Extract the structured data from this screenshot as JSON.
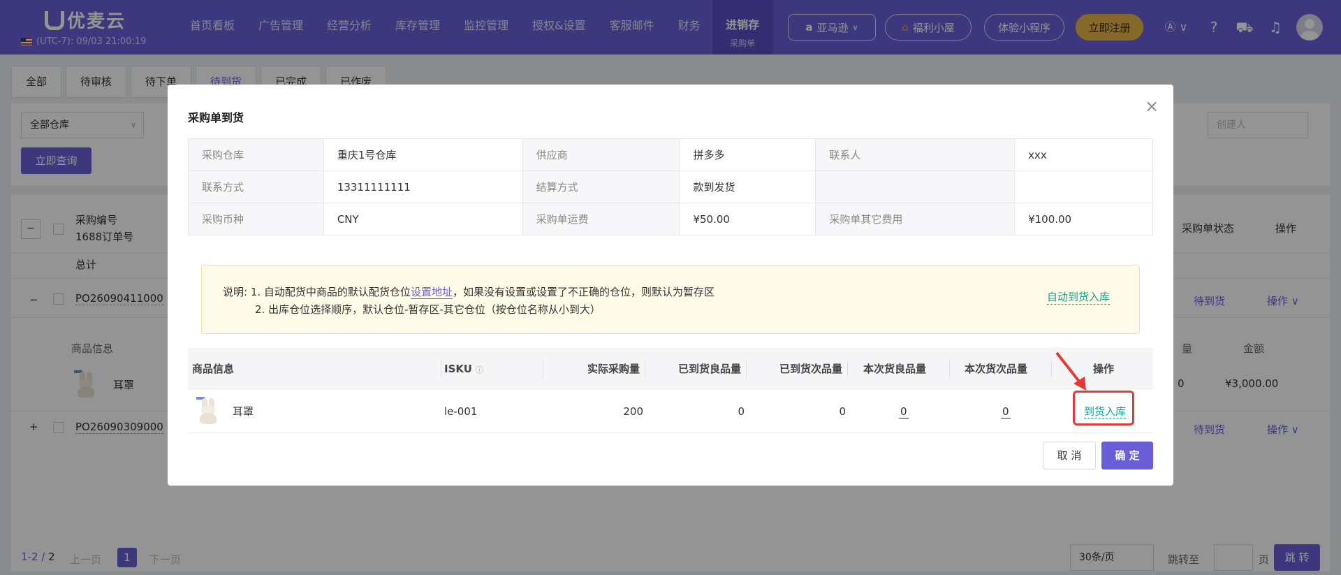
{
  "header": {
    "brand": "优麦云",
    "timezone": "(UTC-7): 09/03 21:00:19",
    "nav": [
      "首页看板",
      "广告管理",
      "经营分析",
      "库存管理",
      "监控管理",
      "授权&设置",
      "客服邮件",
      "财务"
    ],
    "active_nav": "进销存",
    "active_nav_sub": "采购单",
    "platform": "亚马逊",
    "welfare": "福利小屋",
    "mini_program": "体验小程序",
    "register": "立即注册"
  },
  "page": {
    "tabs": [
      "全部",
      "待审核",
      "待下单",
      "待到货",
      "已完成",
      "已作废"
    ],
    "active_tab": "待到货",
    "warehouse_select": "全部仓库",
    "creator_placeholder": "创建人",
    "query_button": "立即查询",
    "list_headers": {
      "po_no": "采购编号",
      "order_1688": "1688订单号",
      "total": "总计",
      "po_status": "采购单状态",
      "ops": "操作",
      "product_info": "商品信息",
      "qty": "量",
      "amount": "金额"
    },
    "rows": [
      {
        "po": "PO26090411000",
        "status": "待到货",
        "ops": "操作"
      },
      {
        "po": "PO26090309000",
        "status": "待到货",
        "ops": "操作"
      }
    ],
    "sub_item": {
      "name": "耳罩",
      "qty": "0",
      "amount": "¥3,000.00"
    },
    "pagination": {
      "range": "1-2",
      "total": "2",
      "prev": "上一页",
      "current": "1",
      "next": "下一页",
      "page_size": "30条/页",
      "jump_label": "跳转至",
      "page_unit": "页",
      "jump_button": "跳 转"
    }
  },
  "modal": {
    "title": "采购单到货",
    "info": {
      "warehouse_label": "采购仓库",
      "warehouse": "重庆1号仓库",
      "supplier_label": "供应商",
      "supplier": "拼多多",
      "contact_label": "联系人",
      "contact": "xxx",
      "phone_label": "联系方式",
      "phone": "13311111111",
      "settle_label": "结算方式",
      "settle": "款到发货",
      "currency_label": "采购币种",
      "currency": "CNY",
      "freight_label": "采购单运费",
      "freight": "¥50.00",
      "other_fee_label": "采购单其它费用",
      "other_fee": "¥100.00"
    },
    "notice": {
      "prefix": "说明:",
      "line1_a": "1. 自动配货中商品的默认配货仓位",
      "line1_link": "设置地址",
      "line1_b": "，如果没有设置或设置了不正确的仓位，则默认为暂存区",
      "line2": "2. 出库仓位选择顺序，默认仓位-暂存区-其它仓位（按仓位名称从小到大）",
      "auto_button": "自动到货入库"
    },
    "grid": {
      "headers": [
        "商品信息",
        "ISKU",
        "实际采购量",
        "已到货良品量",
        "已到货次品量",
        "本次货良品量",
        "本次货次品量",
        "操作"
      ],
      "row": {
        "name": "耳罩",
        "isku": "le-001",
        "actual_qty": "200",
        "arrived_good": "0",
        "arrived_bad": "0",
        "this_good": "0",
        "this_bad": "0",
        "action": "到货入库"
      }
    },
    "cancel": "取 消",
    "confirm": "确 定"
  },
  "colors": {
    "primary": "#6a5fd8",
    "link_teal": "#1a9e8f",
    "highlight_red": "#e53935",
    "gold": "#e6b54a"
  }
}
